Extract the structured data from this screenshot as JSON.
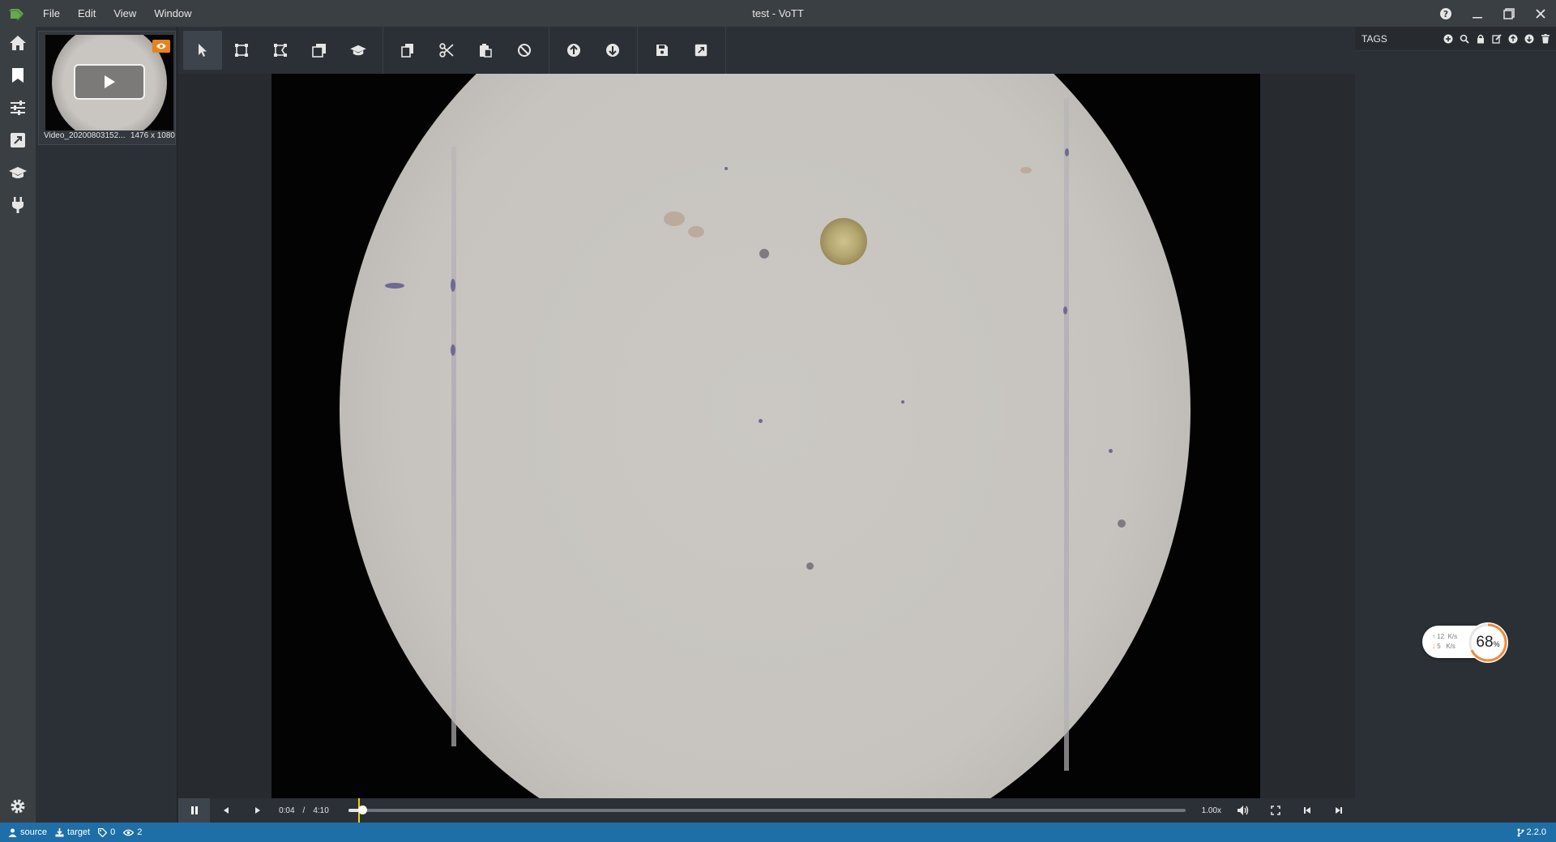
{
  "window": {
    "title": "test - VoTT",
    "menu": [
      "File",
      "Edit",
      "View",
      "Window"
    ]
  },
  "asset": {
    "name": "Video_20200803152...",
    "resolution": "1476 x 1080"
  },
  "video": {
    "current_time": "0:04",
    "separator": "/",
    "duration": "4:10",
    "speed": "1.00x",
    "progress": 0.016
  },
  "tags_panel": {
    "title": "TAGS"
  },
  "network": {
    "up_value": "12",
    "up_unit": "K/s",
    "down_value": "5",
    "down_unit": "K/s",
    "percent": "68",
    "percent_sign": "%",
    "percent_fraction": 0.68
  },
  "statusbar": {
    "source": "source",
    "target": "target",
    "tag_count": "0",
    "visited_count": "2",
    "version": "2.2.0"
  },
  "colors": {
    "accent_blue": "#1e6fa8",
    "logo_green": "#6aa84f",
    "badge_orange": "#e8831c",
    "seek_marker": "#f2d200"
  }
}
